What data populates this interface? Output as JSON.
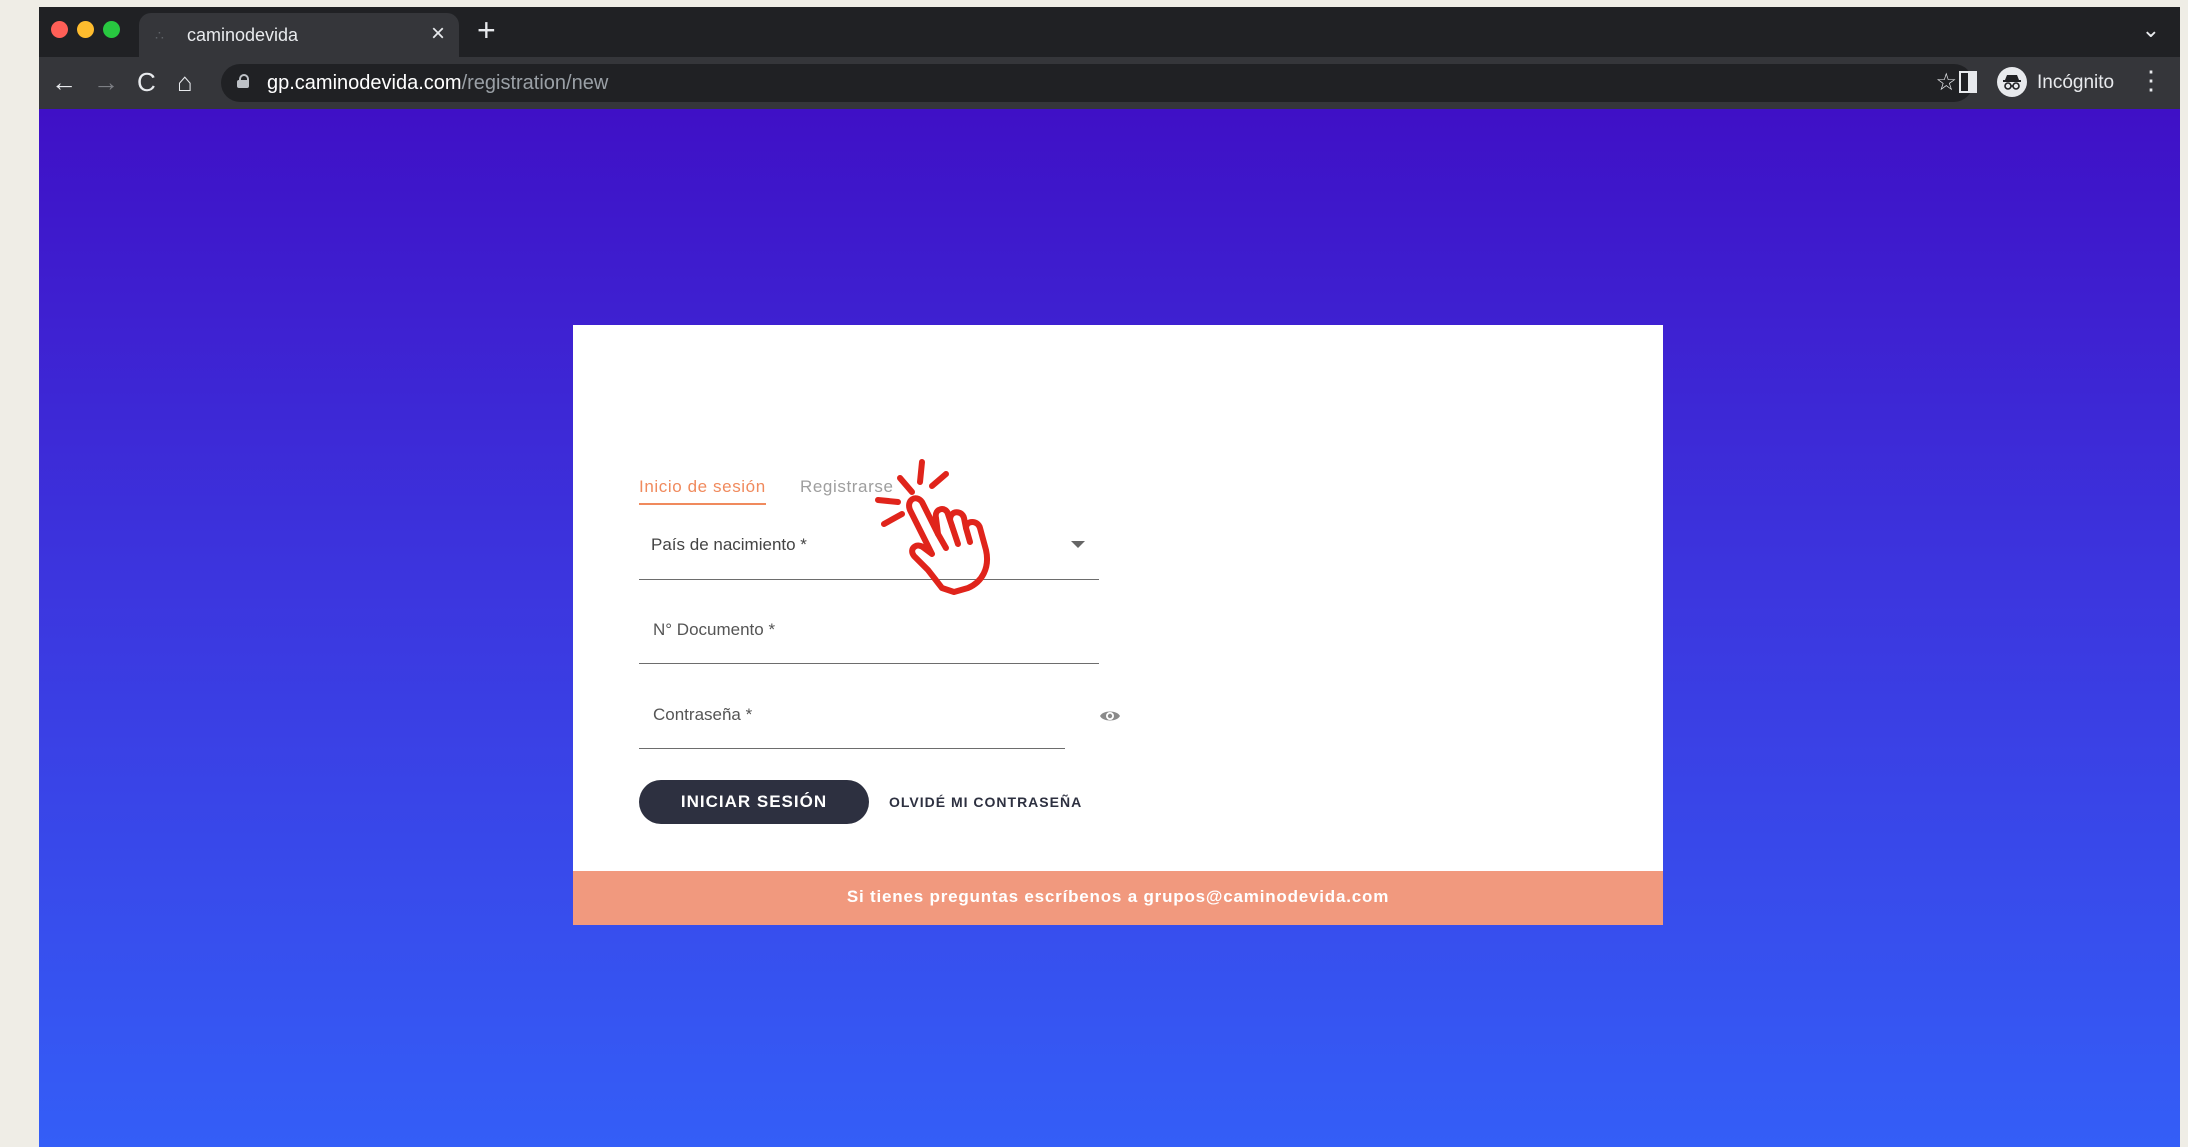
{
  "browser": {
    "tab_title": "caminodevida",
    "tab_close": "×",
    "new_tab": "+",
    "tab_list": "⌄",
    "back": "←",
    "forward": "→",
    "reload": "C",
    "home": "⌂",
    "url_host": "gp.caminodevida.com",
    "url_path": "/registration/new",
    "bookmark": "☆",
    "profile_label": "Incógnito",
    "menu": "⋮"
  },
  "login": {
    "tab_login": "Inicio de sesión",
    "tab_register": "Registrarse",
    "country_label": "País de nacimiento *",
    "document_placeholder": "N° Documento *",
    "password_placeholder": "Contraseña *",
    "submit_label": "INICIAR SESIÓN",
    "forgot_label": "OLVIDÉ MI CONTRASEÑA",
    "footer_text": "Si tienes preguntas escríbenos a grupos@caminodevida.com"
  },
  "colors": {
    "accent": "#f08a5d",
    "button": "#2d3040",
    "footer": "#f1997e",
    "gradient_top": "#3f10c6",
    "gradient_bottom": "#345ef7",
    "annotation": "#e0241b"
  },
  "icons": [
    "tab-favicon-icon",
    "close-icon",
    "plus-icon",
    "chevron-down-icon",
    "back-icon",
    "forward-icon",
    "reload-icon",
    "home-icon",
    "lock-icon",
    "star-icon",
    "side-panel-icon",
    "incognito-icon",
    "menu-icon",
    "dropdown-arrow-icon",
    "eye-icon",
    "pointing-hand-icon"
  ]
}
